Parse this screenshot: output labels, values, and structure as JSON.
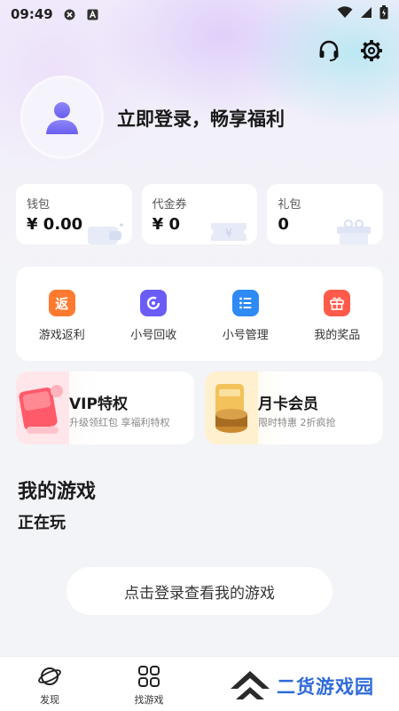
{
  "status_bar": {
    "time": "09:49"
  },
  "header": {
    "login_prompt": "立即登录，畅享福利"
  },
  "wallet": [
    {
      "label": "钱包",
      "value": "¥ 0.00"
    },
    {
      "label": "代金券",
      "value": "¥ 0"
    },
    {
      "label": "礼包",
      "value": "0"
    }
  ],
  "tools": [
    {
      "label": "游戏返利",
      "icon": "rebate-icon",
      "glyph": "返",
      "color": "#ff7a2e"
    },
    {
      "label": "小号回收",
      "icon": "recycle-icon",
      "color": "#6a5cf5"
    },
    {
      "label": "小号管理",
      "icon": "list-manage-icon",
      "color": "#2e8af5"
    },
    {
      "label": "我的奖品",
      "icon": "gift-icon",
      "color": "#ff5a4a"
    }
  ],
  "promos": {
    "vip": {
      "title": "VIP特权",
      "subtitle": "升级领红包 享福利特权"
    },
    "monthly": {
      "title": "月卡会员",
      "subtitle": "限时特惠 2折疯抢"
    }
  },
  "my_games": {
    "title": "我的游戏",
    "playing": "正在玩",
    "login_button": "点击登录查看我的游戏"
  },
  "bottom_nav": [
    {
      "label": "发现",
      "icon": "planet-icon"
    },
    {
      "label": "找游戏",
      "icon": "grid-icon"
    }
  ],
  "watermark": {
    "text": "二货游戏园"
  }
}
